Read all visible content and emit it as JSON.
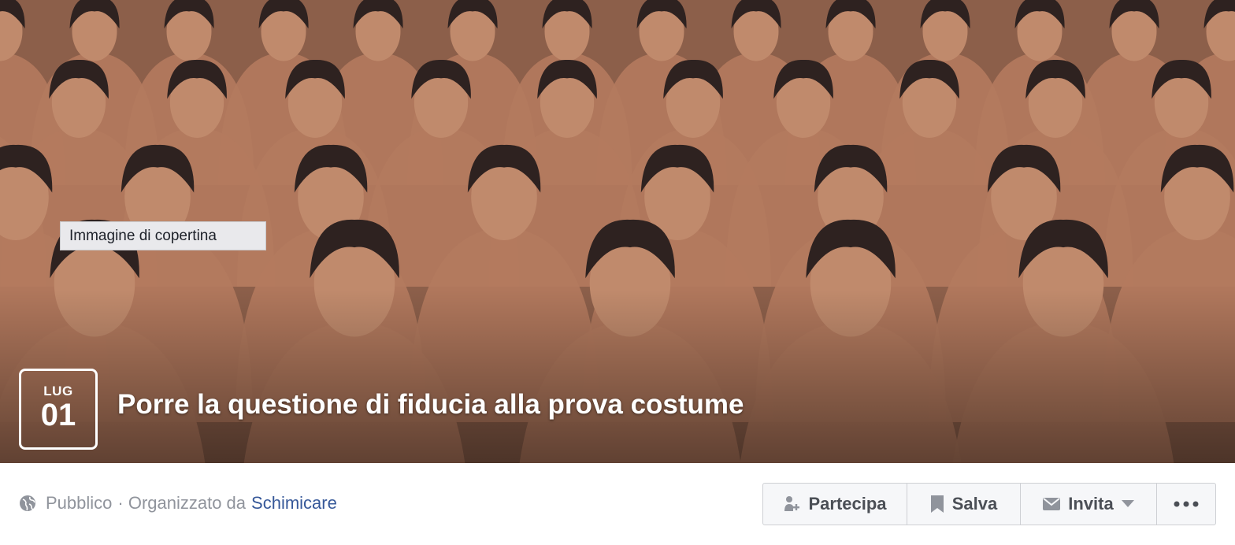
{
  "cover": {
    "tooltip": "Immagine di copertina",
    "date": {
      "month": "LUG",
      "day": "01"
    },
    "title": "Porre la questione di fiducia alla prova costume"
  },
  "info": {
    "privacy": "Pubblico",
    "organized_by_prefix": "· Organizzato da",
    "organizer": "Schimicare"
  },
  "actions": {
    "going_label": "Partecipa",
    "save_label": "Salva",
    "invite_label": "Invita"
  },
  "icons": {
    "privacy": "globe-icon",
    "going": "person-add-icon",
    "save": "bookmark-icon",
    "invite": "envelope-icon",
    "invite_dropdown": "caret-down-icon",
    "more": "more-icon"
  },
  "colors": {
    "link": "#365899",
    "muted_text": "#90949c",
    "button_text": "#4b4f56",
    "button_bg": "#f6f7f9",
    "button_border": "#ced0d4"
  }
}
